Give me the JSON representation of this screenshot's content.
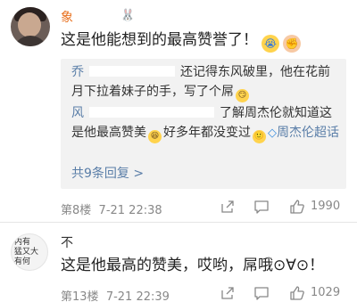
{
  "comments": [
    {
      "author": "象",
      "badge": "🐰",
      "text": "这是他能想到的最高赞誉了！",
      "replies": [
        {
          "author": "乔",
          "text": "还记得东风破里，他在花前月下拉着妹子的手，写了个屌"
        },
        {
          "author": "风",
          "text_a": "了解周杰伦就知道这是他最高赞美",
          "text_b": "好多年都没变过",
          "link": "周杰伦超话"
        }
      ],
      "more_replies": "共9条回复 >",
      "floor": "第8楼",
      "time": "7-21 22:38",
      "likes": "1990"
    },
    {
      "author": "不",
      "avatar_text": [
        "内有",
        "猛又大",
        "有何"
      ],
      "text": "这是他最高的赞美，哎哟，屌哦⊙∀⊙！",
      "floor": "第13楼",
      "time": "7-21 22:39",
      "likes": "1029"
    }
  ],
  "icons": {
    "share": "share-icon",
    "comment": "comment-icon",
    "like": "thumbs-up-icon",
    "cry_emoji": "crying-face-icon",
    "fist_emoji": "fist-icon",
    "smirk_emoji": "smirk-face-icon",
    "laugh_emoji": "laughing-face-icon",
    "smile_emoji": "smile-face-icon",
    "diamond": "diamond-icon"
  },
  "colors": {
    "author_accent": "#e8701e",
    "link": "#5a7ea8",
    "meta_gray": "#888888",
    "reply_bg": "#f2f2f2"
  }
}
